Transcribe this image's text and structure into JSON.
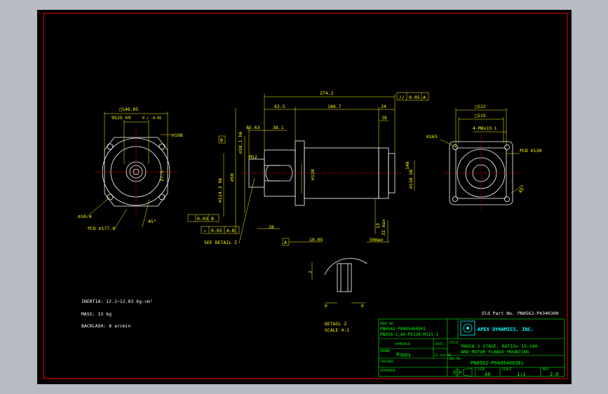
{
  "colors": {
    "background": "#000000",
    "frame": "#ff0000",
    "geometry": "#ffffff",
    "dimension": "#ffff00",
    "centerline": "#ff0000",
    "title_block": "#00ff00",
    "logo": "#00ffff",
    "window": "#b7bcc4"
  },
  "left_view": {
    "dim_square": "□146.05",
    "dim_pilot": "9525 h9",
    "dim_pilot_tol": "0 / -0.05",
    "dim_dia198": "⌀198",
    "dim_275": "27.5",
    "dim_hole": "⌀10.4",
    "dim_pcd": "PCD ⌀177.8",
    "angle": "45°"
  },
  "front_view": {
    "dim_overall": "274.2",
    "parallel_sym": "//",
    "parallel_tol": "0.05",
    "parallel_ref": "A",
    "dim_635": "63.5",
    "dim_1867": "186.7",
    "dim_24": "24",
    "dim_8563": "85.63",
    "dim_381": "38.1",
    "dim_18": "18",
    "dim_pilot_v": "⌀38.1 h6",
    "dim_pilot_v2": "⌀114.3 h6",
    "dim_shaft": "⌀50",
    "dim_body": "⌀120",
    "dim_motor_pilot": "⌀110 G6",
    "dim_m12": "M12",
    "datum_b": "B",
    "datum_a": "A",
    "flat_tol": "0.03",
    "flat_ref": "B",
    "runout_sym": "↗",
    "runout_tol": "0.03",
    "runout_ref": "A-B",
    "see_detail": "SEE DETAIL Z",
    "dim_1905": "19.05",
    "dim_28": "28",
    "dim_13": "13",
    "dim_32max": "32 max",
    "dim_50max": "50max",
    "dim_140": "140"
  },
  "right_view": {
    "dim_sq122": "□122",
    "dim_sq115": "□115",
    "dim_bolts": "4-M8x15 L",
    "dim_dia163": "⌀163",
    "dim_pcd130": "PCD ⌀130",
    "angle": "45°"
  },
  "detail": {
    "dim_2": "2",
    "dim_p1": "P",
    "dim_p2": "P",
    "title": "DETAIL Z",
    "scale": "SCALE 4:1"
  },
  "notes": {
    "inertia": "INERTIA: 12.1~12.03 kg-cm²",
    "mass": "MASS: 13 kg",
    "backlash": "BACKLASH: 8 arcmin",
    "old_part": "Old Part No. PN0562-P4340300"
  },
  "title_block": {
    "part_no_label": "PART NO.",
    "part_no_1": "PN0562-P0405400301",
    "part_no_2": "PN056-2,A0-PE120-M115-1",
    "approved_by": "APPROVED",
    "date_label": "DATE",
    "drawn_label": "DRAWN",
    "drawn_name": "Poppy",
    "drawn_date": "13-Jun-08",
    "checked_label": "CHECKED",
    "approved_label": "APPROVED",
    "title_label": "TITLE",
    "title_line1": "PN056 2 STAGE, RATIO= 15~100",
    "title_line2": "AND MOTOR FLANGE MOUNTING",
    "dwg_label": "DWG NO.",
    "dwg_no": "PN0562-P0405400301",
    "size_label": "SIZE",
    "size": "A0",
    "scale_label": "SCALE",
    "scale": "1:1",
    "rev_label": "REV",
    "rev": "2.0",
    "company": "APEX DYNAMICS, INC."
  }
}
